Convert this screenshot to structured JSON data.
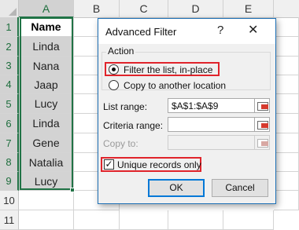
{
  "sheet": {
    "columns": [
      "A",
      "B",
      "C",
      "D",
      "E"
    ],
    "rows": [
      "1",
      "2",
      "3",
      "4",
      "5",
      "6",
      "7",
      "8",
      "9",
      "10",
      "11"
    ],
    "header_cell": "Name",
    "names": [
      "Linda",
      "Nana",
      "Jaap",
      "Lucy",
      "Linda",
      "Gene",
      "Natalia",
      "Lucy"
    ]
  },
  "dialog": {
    "title": "Advanced Filter",
    "help_icon": "?",
    "close_icon": "✕",
    "action_label": "Action",
    "radio_filter": "Filter the list, in-place",
    "radio_copy": "Copy to another location",
    "list_range_label": "List range:",
    "list_range_value": "$A$1:$A$9",
    "criteria_label": "Criteria range:",
    "criteria_value": "",
    "copy_to_label": "Copy to:",
    "copy_to_value": "",
    "unique_label": "Unique records only",
    "unique_checked": true,
    "ok_label": "OK",
    "cancel_label": "Cancel"
  },
  "icons": {
    "range_picker": "range-selector-icon",
    "close": "close-icon",
    "help": "help-icon"
  },
  "colors": {
    "selection_green": "#217346",
    "highlight_red": "#e0242b",
    "dialog_border": "#1c6fb5"
  }
}
